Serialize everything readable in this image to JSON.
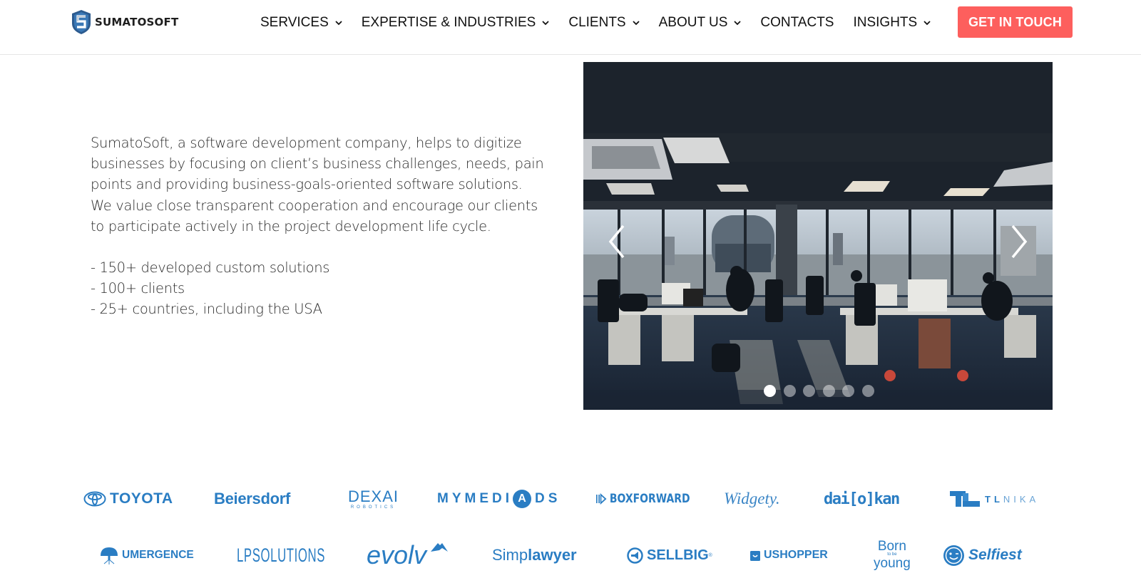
{
  "header": {
    "logo_text": "SUMATOSOFT",
    "nav": [
      {
        "label": "SERVICES",
        "has_dropdown": true
      },
      {
        "label": "EXPERTISE & INDUSTRIES",
        "has_dropdown": true
      },
      {
        "label": "CLIENTS",
        "has_dropdown": true
      },
      {
        "label": "ABOUT US",
        "has_dropdown": true
      },
      {
        "label": "CONTACTS",
        "has_dropdown": false
      },
      {
        "label": "INSIGHTS",
        "has_dropdown": true
      }
    ],
    "cta_label": "GET IN TOUCH",
    "cta_color": "#fd5f5d"
  },
  "intro": {
    "paragraph": "SumatoSoft, a software development company, helps to digitize businesses by focusing on client’s business challenges, needs, pain points and providing business-goals-oriented software solutions. We value close transparent cooperation and encourage our clients to participate actively in the project development life cycle.",
    "stats": [
      "- 150+ developed custom solutions",
      "- 100+ clients",
      "- 25+ countries, including the USA"
    ]
  },
  "slider": {
    "image_description": "open-plan office with panoramic windows and city view",
    "prev_icon": "chevron-left-icon",
    "next_icon": "chevron-right-icon",
    "slide_count": 6,
    "active_slide": 1
  },
  "clients": {
    "brand_color": "#2a7dc3",
    "row1": {
      "toyota": "TOYOTA",
      "beiersdorf": "Beiersdorf",
      "dexai": "DEXAI",
      "dexai_sub": "ROBOTICS",
      "mymediads_pre": "MYMEDI",
      "mymediads_circle": "A",
      "mymediads_post": "DS",
      "boxforward": "BOXFORWARD",
      "widgety": "Widgety.",
      "daiokan": "dai[o]kan",
      "tlnika_bold": "TL",
      "tlnika_light": "NIKA"
    },
    "row2": {
      "umergence": "UMERGENCE",
      "lpsolutions": "LPSOLUTIONS",
      "evolv": "evolv",
      "simplawyer_light": "Simp",
      "simplawyer_bold": "lawyer",
      "sellbig": "SELLBIG",
      "sellbig_mark": "®",
      "ushopper": "USHOPPER",
      "born_top": "Born",
      "born_mid": "to be",
      "born_bottom": "young",
      "selfiest": "Selfiest"
    }
  }
}
